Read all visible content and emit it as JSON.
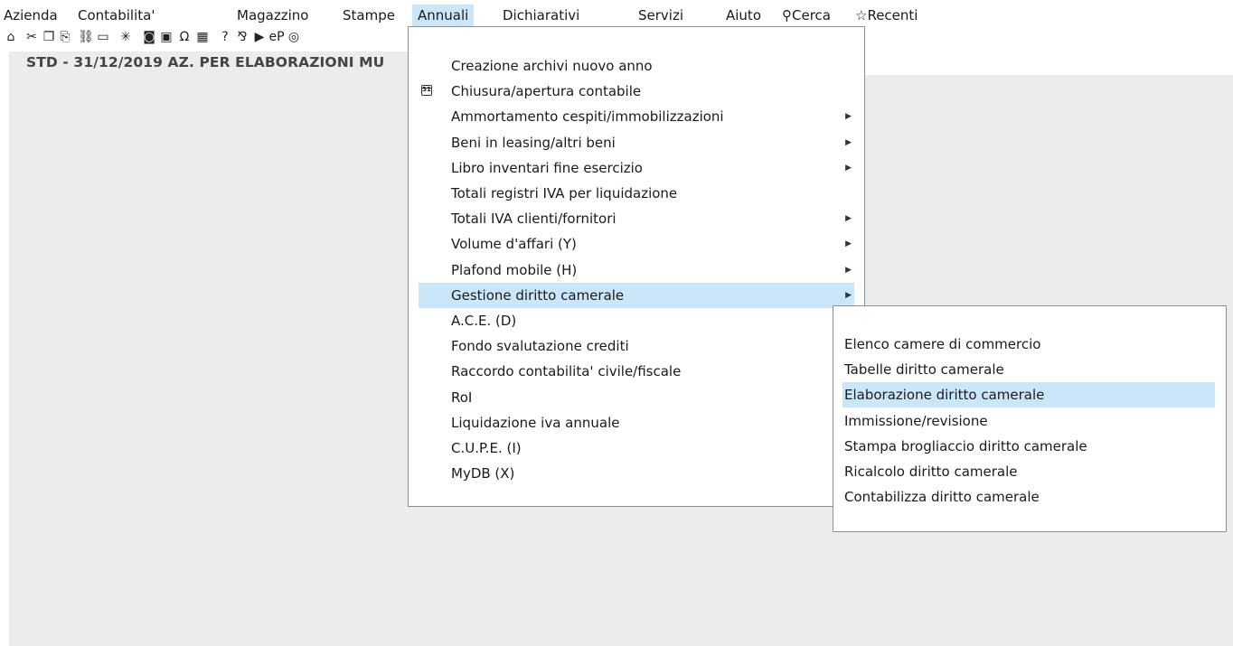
{
  "menubar": {
    "items": [
      "Azienda",
      "Contabilita'",
      "Magazzino",
      "Stampe",
      "Annuali",
      "Dichiarativi",
      "Servizi",
      "Aiuto"
    ],
    "cerca": "Cerca",
    "recenti": "Recenti",
    "active": "Annuali"
  },
  "toolbar": {
    "icons": [
      "home-icon",
      "cut-icon",
      "copy-icon",
      "paste-icon",
      "link-icon",
      "monitor-icon",
      "shrink-icon",
      "camera-icon",
      "calendar-icon",
      "omega-icon",
      "calculator-icon",
      "help-icon",
      "translate-icon",
      "play-icon",
      "ep-icon",
      "chat-icon"
    ],
    "glyphs": [
      "⌂",
      "✂",
      "❐",
      "⎘",
      "⛓",
      "▭",
      "✳",
      "◙",
      "▣",
      "Ω",
      "▦",
      "?",
      "⅋",
      "▶",
      "eP",
      "◎"
    ]
  },
  "company": {
    "text": "STD - 31/12/2019  AZ. PER ELABORAZIONI MU"
  },
  "annuali_menu": {
    "items": [
      {
        "label": "Creazione archivi nuovo anno",
        "submenu": false
      },
      {
        "label": "Chiusura/apertura contabile",
        "submenu": false,
        "icon": "calendar-31-icon",
        "icon_text": "31"
      },
      {
        "label": "Ammortamento cespiti/immobilizzazioni",
        "submenu": true
      },
      {
        "label": "Beni in leasing/altri beni",
        "submenu": true
      },
      {
        "label": "Libro inventari fine esercizio",
        "submenu": true
      },
      {
        "label": "Totali registri IVA per liquidazione",
        "submenu": false
      },
      {
        "label": "Totali IVA clienti/fornitori",
        "submenu": true
      },
      {
        "label": "Volume d'affari (Y)",
        "submenu": true
      },
      {
        "label": "Plafond mobile (H)",
        "submenu": true
      },
      {
        "label": "Gestione diritto camerale",
        "submenu": true,
        "highlighted": true
      },
      {
        "label": "A.C.E. (D)",
        "submenu": false
      },
      {
        "label": "Fondo svalutazione crediti",
        "submenu": false
      },
      {
        "label": "Raccordo contabilita' civile/fiscale",
        "submenu": false
      },
      {
        "label": "RoI",
        "submenu": false
      },
      {
        "label": "Liquidazione iva annuale",
        "submenu": false
      },
      {
        "label": "C.U.P.E. (I)",
        "submenu": false
      },
      {
        "label": "MyDB (X)",
        "submenu": false
      }
    ],
    "arrow_glyph": "▶"
  },
  "submenu": {
    "items": [
      {
        "label": "Elenco camere di commercio"
      },
      {
        "label": "Tabelle diritto camerale"
      },
      {
        "label": "Elaborazione diritto camerale",
        "highlighted": true
      },
      {
        "label": "Immissione/revisione"
      },
      {
        "label": "Stampa brogliaccio diritto camerale"
      },
      {
        "label": "Ricalcolo diritto camerale"
      },
      {
        "label": "Contabilizza diritto camerale"
      }
    ]
  },
  "colors": {
    "highlight": "#cce6f9",
    "workspace": "#ececec",
    "border": "#8f8f8f"
  }
}
